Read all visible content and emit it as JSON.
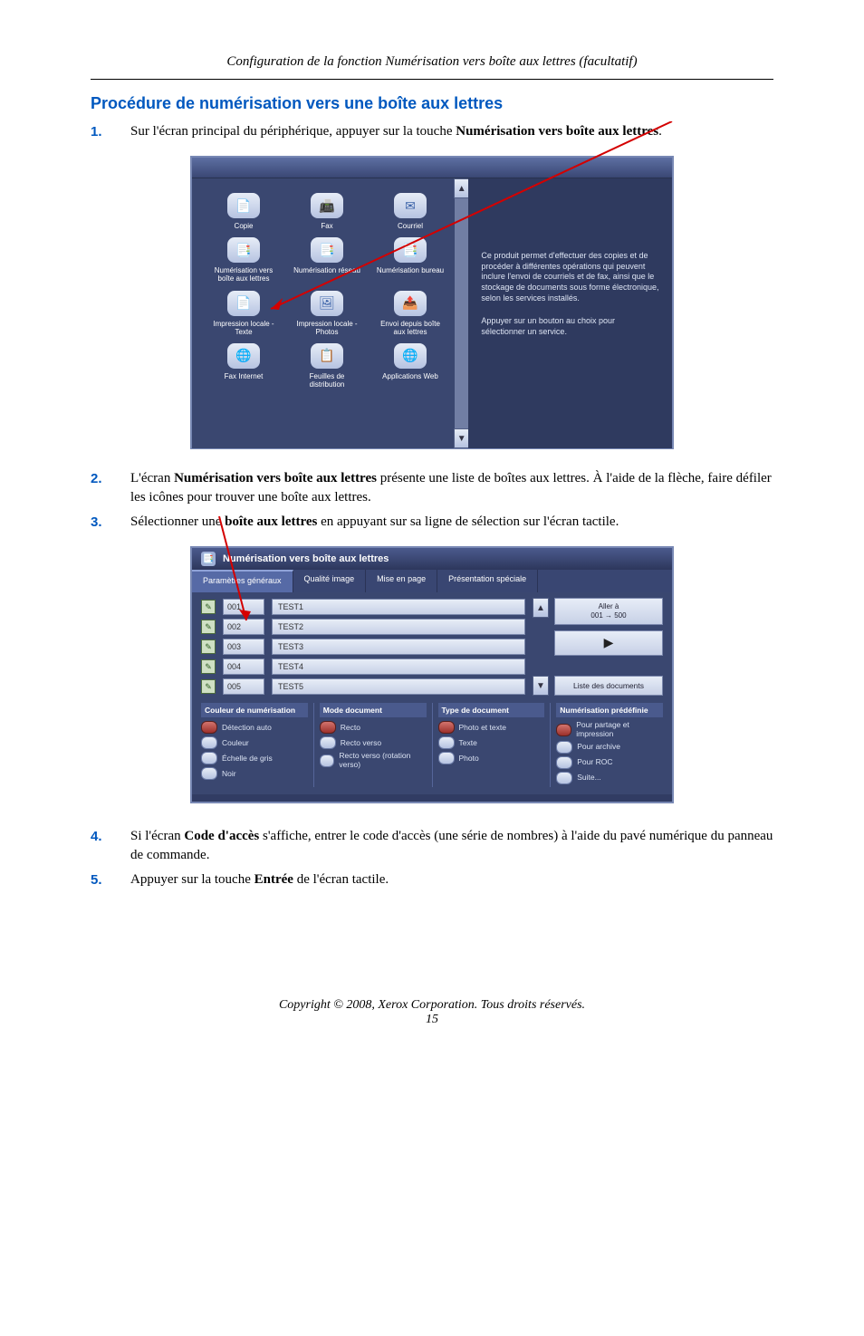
{
  "header_title": "Configuration de la fonction Numérisation vers boîte aux lettres (facultatif)",
  "section_heading": "Procédure de numérisation vers une boîte aux lettres",
  "steps": [
    {
      "num": "1.",
      "text_a": "Sur l'écran principal du périphérique, appuyer sur la touche ",
      "bold": "Numérisation vers boîte aux lettres",
      "text_b": "."
    },
    {
      "num": "2.",
      "text_a": "L'écran ",
      "bold": "Numérisation vers boîte aux lettres",
      "text_b": " présente une liste de boîtes aux lettres. À l'aide de la flèche, faire défiler les icônes pour trouver une boîte aux lettres."
    },
    {
      "num": "3.",
      "text_a": "Sélectionner une ",
      "bold": "boîte aux lettres",
      "text_b": " en appuyant sur sa ligne de sélection sur l'écran tactile."
    },
    {
      "num": "4.",
      "text_a": "Si l'écran ",
      "bold": "Code d'accès",
      "text_b": " s'affiche, entrer le code d'accès (une série de nombres) à l'aide du pavé numérique du panneau de commande."
    },
    {
      "num": "5.",
      "text_a": "Appuyer sur la touche ",
      "bold": "Entrée",
      "text_b": " de l'écran tactile."
    }
  ],
  "services": [
    {
      "label": "Copie",
      "icon": "📄"
    },
    {
      "label": "Fax",
      "icon": "📠"
    },
    {
      "label": "Courriel",
      "icon": "✉"
    },
    {
      "label": "Numérisation vers boîte aux lettres",
      "icon": "📑"
    },
    {
      "label": "Numérisation réseau",
      "icon": "📑"
    },
    {
      "label": "Numérisation bureau",
      "icon": "📑"
    },
    {
      "label": "Impression locale - Texte",
      "icon": "📄"
    },
    {
      "label": "Impression locale - Photos",
      "icon": "🖼"
    },
    {
      "label": "Envoi depuis boîte aux lettres",
      "icon": "📤"
    },
    {
      "label": "Fax Internet",
      "icon": "🌐"
    },
    {
      "label": "Feuilles de distribution",
      "icon": "📋"
    },
    {
      "label": "Applications Web",
      "icon": "🌐"
    }
  ],
  "info_text_1": "Ce produit permet d'effectuer des copies et de procéder à différentes opérations qui peuvent inclure l'envoi de courriels et de fax, ainsi que le stockage de documents sous forme électronique, selon les services installés.",
  "info_text_2": "Appuyer sur un bouton au choix pour sélectionner un service.",
  "mailbox_title": "Numérisation vers boîte aux lettres",
  "tabs": [
    "Paramètres généraux",
    "Qualité image",
    "Mise en page",
    "Présentation spéciale"
  ],
  "mailboxes": [
    {
      "num": "001",
      "name": "TEST1"
    },
    {
      "num": "002",
      "name": "TEST2"
    },
    {
      "num": "003",
      "name": "TEST3"
    },
    {
      "num": "004",
      "name": "TEST4"
    },
    {
      "num": "005",
      "name": "TEST5"
    }
  ],
  "goto_label": "Aller à\n001 → 500",
  "doclist_label": "Liste des documents",
  "option_groups": [
    {
      "head": "Couleur de numérisation",
      "items": [
        "Détection auto",
        "Couleur",
        "Échelle de gris",
        "Noir"
      ],
      "selected": 0
    },
    {
      "head": "Mode document",
      "items": [
        "Recto",
        "Recto verso",
        "Recto verso (rotation verso)"
      ],
      "selected": 0
    },
    {
      "head": "Type de document",
      "items": [
        "Photo et texte",
        "Texte",
        "Photo"
      ],
      "selected": 0
    },
    {
      "head": "Numérisation prédéfinie",
      "items": [
        "Pour partage et impression",
        "Pour archive",
        "Pour ROC",
        "Suite..."
      ],
      "selected": 0
    }
  ],
  "copyright": "Copyright © 2008, Xerox Corporation. Tous droits réservés.",
  "page_number": "15"
}
